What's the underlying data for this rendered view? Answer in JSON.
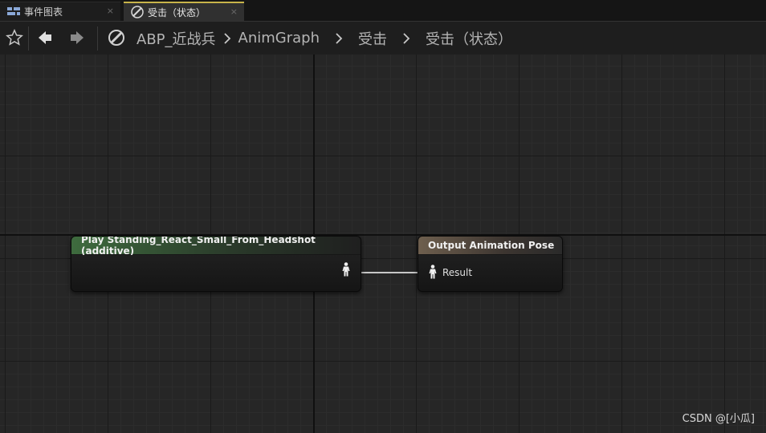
{
  "tabs": [
    {
      "label": "事件图表",
      "icon": "event-graph-icon",
      "close": "×"
    },
    {
      "label": "受击（状态）",
      "icon": "state-icon",
      "close": "×"
    }
  ],
  "breadcrumb": {
    "root": "ABP_近战兵",
    "items": [
      "AnimGraph",
      "受击",
      "受击（状态）"
    ],
    "separator_icon": "chevron-right-icon"
  },
  "nodes": {
    "play_node": {
      "title": "Play Standing_React_Small_From_Headshot (additive)",
      "header_color": "#3e6b3e"
    },
    "output_node": {
      "title": "Output Animation Pose",
      "pin_label": "Result",
      "header_color": "#6e5f4e"
    }
  },
  "colors": {
    "background": "#262626",
    "grid_major": "#1a1a1a",
    "grid_minor": "#2c2c2c",
    "wire": "#c8c8c8"
  },
  "watermark": "CSDN @[小瓜]"
}
